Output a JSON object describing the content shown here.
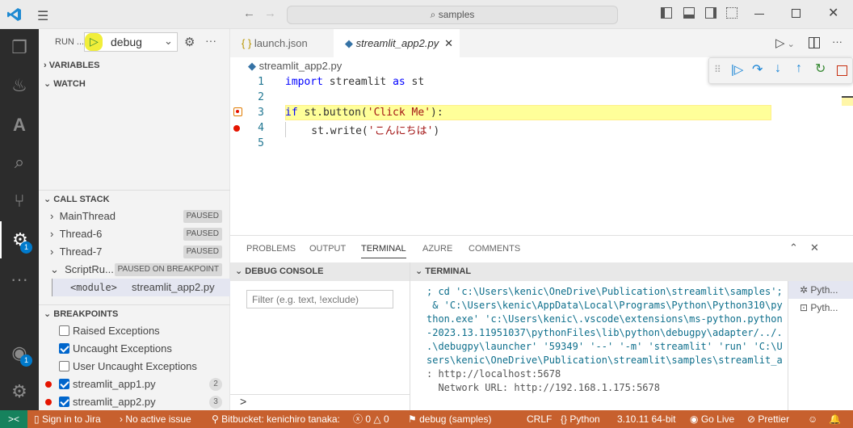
{
  "titlebar": {
    "search": "samples",
    "search_icon": "search-icon"
  },
  "activity": {
    "debug_badge": "1",
    "account_badge": "1"
  },
  "sidebar": {
    "run_label": "RUN ...",
    "config": "debug",
    "variables": "VARIABLES",
    "watch": "WATCH",
    "call_stack": "CALL STACK",
    "threads": [
      {
        "name": "MainThread",
        "state": "PAUSED"
      },
      {
        "name": "Thread-6",
        "state": "PAUSED"
      },
      {
        "name": "Thread-7",
        "state": "PAUSED"
      },
      {
        "name": "ScriptRu...",
        "state": "PAUSED ON BREAKPOINT"
      }
    ],
    "frame": {
      "name": "<module>",
      "file": "streamlit_app2.py"
    },
    "breakpoints_title": "BREAKPOINTS",
    "breakpoints": [
      {
        "label": "Raised Exceptions",
        "checked": false
      },
      {
        "label": "Uncaught Exceptions",
        "checked": true
      },
      {
        "label": "User Uncaught Exceptions",
        "checked": false
      },
      {
        "label": "streamlit_app1.py",
        "checked": true,
        "line": "2"
      },
      {
        "label": "streamlit_app2.py",
        "checked": true,
        "line": "3"
      }
    ]
  },
  "tabs": [
    {
      "label": "launch.json",
      "icon": "{ }"
    },
    {
      "label": "streamlit_app2.py",
      "active": true
    }
  ],
  "breadcrumb": "streamlit_app2.py",
  "code": {
    "lines": [
      "1",
      "2",
      "3",
      "4",
      "5"
    ],
    "l1a": "import",
    "l1b": " streamlit ",
    "l1c": "as",
    "l1d": " st",
    "l3a": "if",
    "l3b": " st.button(",
    "l3c": "'Click Me'",
    "l3d": "):",
    "l4a": "    st.write(",
    "l4b": "'こんにちは'",
    "l4c": ")"
  },
  "panel": {
    "tabs": [
      "PROBLEMS",
      "OUTPUT",
      "TERMINAL",
      "AZURE",
      "COMMENTS"
    ],
    "debug_console": "DEBUG CONSOLE",
    "terminal": "TERMINAL",
    "filter_placeholder": "Filter (e.g. text, !exclude)",
    "prompt": ">",
    "terminal_lines": [
      "; cd 'c:\\Users\\kenic\\OneDrive\\Publication\\streamlit\\samples';",
      " & 'C:\\Users\\kenic\\AppData\\Local\\Programs\\Python\\Python310\\py",
      "thon.exe' 'c:\\Users\\kenic\\.vscode\\extensions\\ms-python.python",
      "-2023.13.11951037\\pythonFiles\\lib\\python\\debugpy\\adapter/../.",
      ".\\debugpy\\launcher' '59349' '--' '-m' 'streamlit' 'run' 'C:\\U",
      "sers\\kenic\\OneDrive\\Publication\\streamlit\\samples\\streamlit_a",
      ": http://localhost:5678",
      "  Network URL: http://192.168.1.175:5678"
    ],
    "terminals": [
      "Pyth...",
      "Pyth..."
    ]
  },
  "status": {
    "jira": "Sign in to Jira",
    "issue": "No active issue",
    "bitbucket": "Bitbucket: kenichiro tanaka:",
    "errors": "0",
    "warnings": "0",
    "debug": "debug (samples)",
    "eol": "CRLF",
    "lang": "Python",
    "version": "3.10.11 64-bit",
    "golive": "Go Live",
    "prettier": "Prettier"
  },
  "colors": {
    "status": "#c7602e",
    "remote": "#16825d",
    "accent": "#007acc",
    "highlight": "#ffff99"
  }
}
